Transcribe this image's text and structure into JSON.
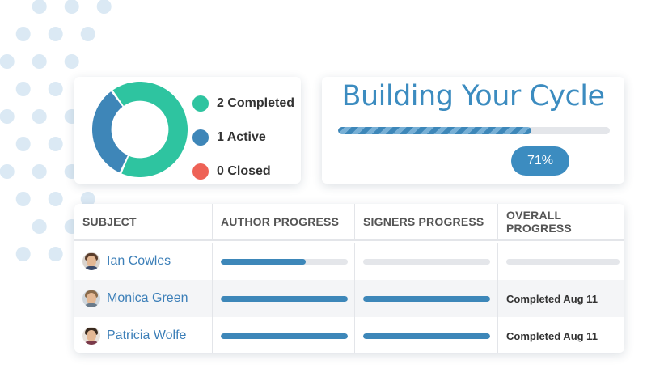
{
  "status_summary": {
    "legend": [
      {
        "label": "2 Completed",
        "color": "#2ec4a0",
        "count": 2
      },
      {
        "label": "1 Active",
        "color": "#3e86b8",
        "count": 1
      },
      {
        "label": "0 Closed",
        "color": "#ee6256",
        "count": 0
      }
    ]
  },
  "cycle": {
    "title": "Building Your Cycle",
    "progress_fraction": 0.71,
    "percent_label": "71%"
  },
  "table": {
    "headers": [
      "SUBJECT",
      "AUTHOR PROGRESS",
      "SIGNERS PROGRESS",
      "OVERALL PROGRESS"
    ],
    "rows": [
      {
        "name": "Ian Cowles",
        "author_progress": 0.67,
        "signers_progress": 0,
        "overall_progress": 0,
        "overall_text": ""
      },
      {
        "name": "Monica Green",
        "author_progress": 1,
        "signers_progress": 1,
        "overall_progress": 1,
        "overall_text": "Completed Aug 11"
      },
      {
        "name": "Patricia Wolfe",
        "author_progress": 1,
        "signers_progress": 1,
        "overall_progress": 1,
        "overall_text": "Completed Aug 11"
      }
    ]
  }
}
